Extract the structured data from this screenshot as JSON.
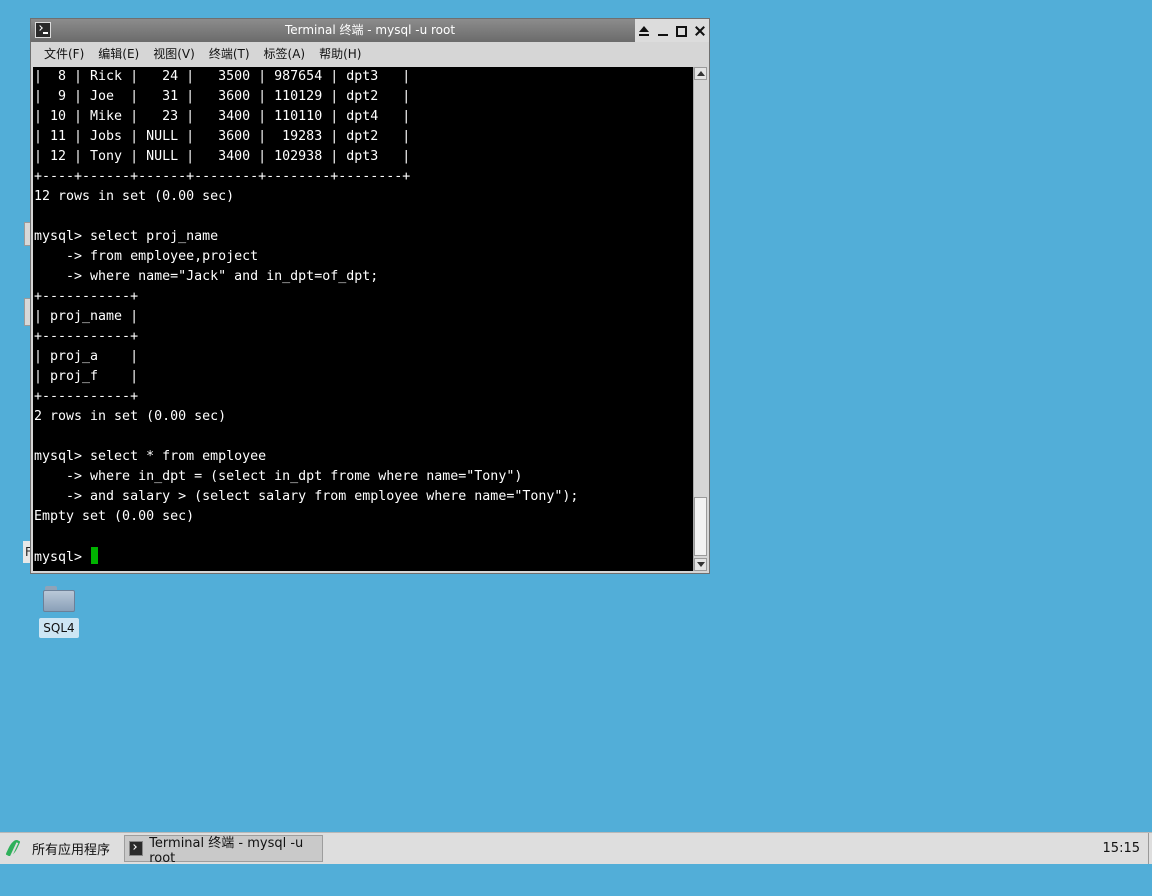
{
  "window": {
    "title": "Terminal 终端 - mysql -u root"
  },
  "menu": [
    "文件(F)",
    "编辑(E)",
    "视图(V)",
    "终端(T)",
    "标签(A)",
    "帮助(H)"
  ],
  "terminal": {
    "lines": [
      "|  8 | Rick |   24 |   3500 | 987654 | dpt3   |",
      "|  9 | Joe  |   31 |   3600 | 110129 | dpt2   |",
      "| 10 | Mike |   23 |   3400 | 110110 | dpt4   |",
      "| 11 | Jobs | NULL |   3600 |  19283 | dpt2   |",
      "| 12 | Tony | NULL |   3400 | 102938 | dpt3   |",
      "+----+------+------+--------+--------+--------+",
      "12 rows in set (0.00 sec)",
      "",
      "mysql> select proj_name",
      "    -> from employee,project",
      "    -> where name=\"Jack\" and in_dpt=of_dpt;",
      "+-----------+",
      "| proj_name |",
      "+-----------+",
      "| proj_a    |",
      "| proj_f    |",
      "+-----------+",
      "2 rows in set (0.00 sec)",
      "",
      "mysql> select * from employee",
      "    -> where in_dpt = (select in_dpt frome where name=\"Tony\")",
      "    -> and salary > (select salary from employee where name=\"Tony\");",
      "Empty set (0.00 sec)",
      ""
    ],
    "prompt": "mysql> ",
    "cursor_color": "#00b400",
    "scroll_position": 1.0
  },
  "desktop": {
    "icons": [
      {
        "label": "SQL4",
        "icon": "folder-icon"
      }
    ]
  },
  "taskbar": {
    "start_label": "所有应用程序",
    "task_label": "Terminal 终端 - mysql -u root",
    "clock": "15:15"
  },
  "colors": {
    "desktop_bg": "#52aed8",
    "terminal_bg": "#000000",
    "terminal_fg": "#ffffff"
  }
}
